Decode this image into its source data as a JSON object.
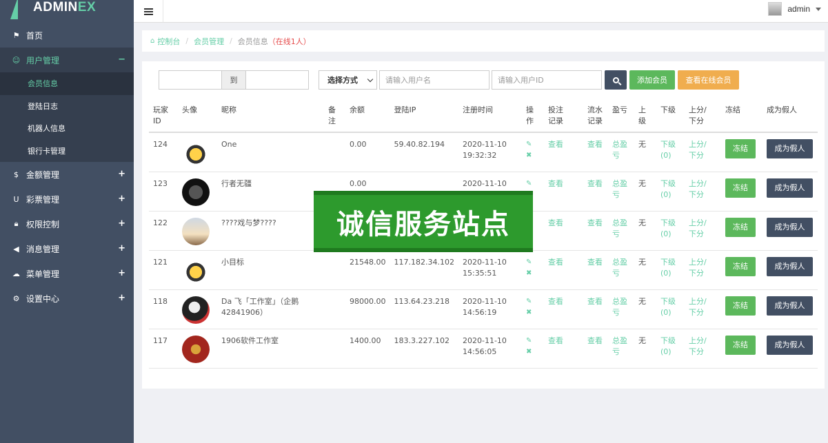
{
  "app": {
    "logo_main": "ADMIN",
    "logo_accent": "EX"
  },
  "topbar": {
    "user_name": "admin"
  },
  "sidebar": {
    "items": [
      {
        "label": "首页",
        "icon": "flag-icon",
        "sign": ""
      },
      {
        "label": "用户管理",
        "icon": "smile-icon",
        "sign": "−"
      },
      {
        "label": "金额管理",
        "icon": "dollar-icon",
        "sign": "+"
      },
      {
        "label": "彩票管理",
        "icon": "magnet-icon",
        "sign": "+"
      },
      {
        "label": "权限控制",
        "icon": "lock-icon",
        "sign": "+"
      },
      {
        "label": "消息管理",
        "icon": "bullhorn-icon",
        "sign": "+"
      },
      {
        "label": "菜单管理",
        "icon": "cloud-icon",
        "sign": "+"
      },
      {
        "label": "设置中心",
        "icon": "gear-icon",
        "sign": "+"
      }
    ],
    "sub_items": [
      "会员信息",
      "登陆日志",
      "机器人信息",
      "银行卡管理"
    ]
  },
  "breadcrumb": {
    "home": "控制台",
    "section": "会员管理",
    "current": "会员信息",
    "online": "（在线1人）"
  },
  "filters": {
    "date_to": "到",
    "mode_select": "选择方式",
    "username_placeholder": "请输入用户名",
    "userid_placeholder": "请输入用户ID",
    "add_label": "添加会员",
    "online_label": "查看在线会员"
  },
  "table": {
    "headers": {
      "id": [
        "玩家",
        "ID"
      ],
      "avatar": "头像",
      "nick": "昵称",
      "note": [
        "备",
        "注"
      ],
      "balance": "余额",
      "ip": "登陆IP",
      "regtime": "注册时间",
      "op": [
        "操",
        "作"
      ],
      "bet": [
        "投注",
        "记录"
      ],
      "flow": [
        "流水",
        "记录"
      ],
      "pl": "盈亏",
      "up": [
        "上",
        "级"
      ],
      "down": "下级",
      "updown": [
        "上分/",
        "下分"
      ],
      "freeze": "冻结",
      "fake": "成为假人"
    },
    "rows": [
      {
        "id": "124",
        "nick": "One",
        "balance": "0.00",
        "ip": "59.40.82.194",
        "date": "2020-11-10",
        "time": "19:32:32",
        "up": "无"
      },
      {
        "id": "123",
        "nick": "行者无疆",
        "balance": "0.00",
        "ip": "",
        "date": "2020-11-10",
        "time": "",
        "up": "无"
      },
      {
        "id": "122",
        "nick": "????戏与梦????",
        "balance": "",
        "ip": "",
        "date": "",
        "time": "",
        "up": "无"
      },
      {
        "id": "121",
        "nick": "小目标",
        "balance": "21548.00",
        "ip": "117.182.34.102",
        "date": "2020-11-10",
        "time": "15:35:51",
        "up": "无"
      },
      {
        "id": "118",
        "nick": "Da 飞「工作室」（企鹅 42841906）",
        "balance": "98000.00",
        "ip": "113.64.23.218",
        "date": "2020-11-10",
        "time": "14:56:19",
        "up": "无"
      },
      {
        "id": "117",
        "nick": "1906软件工作室",
        "balance": "1400.00",
        "ip": "183.3.227.102",
        "date": "2020-11-10",
        "time": "14:56:05",
        "up": "无"
      }
    ],
    "links": {
      "view": "查看",
      "pl": [
        "总盈",
        "亏"
      ],
      "down": [
        "下级",
        "(0)"
      ],
      "up_score": "上分/",
      "down_score": "下分",
      "freeze": "冻结",
      "fake": "成为假人"
    }
  },
  "watermark": "诚信服务站点"
}
